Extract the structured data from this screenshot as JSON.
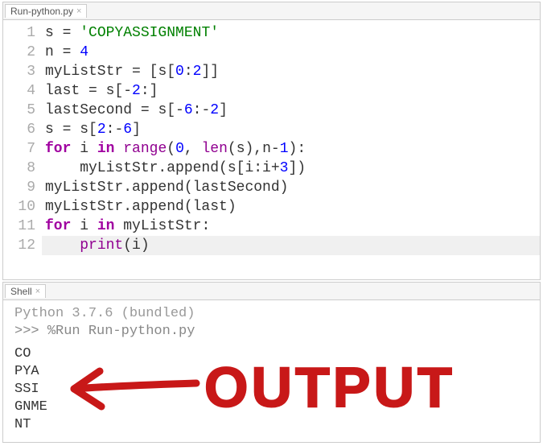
{
  "editor": {
    "tab_label": "Run-python.py",
    "lines": [
      {
        "n": "1",
        "tokens": [
          [
            "s ",
            "d"
          ],
          [
            "= ",
            "d"
          ],
          [
            "'COPYASSIGNMENT'",
            "s"
          ]
        ]
      },
      {
        "n": "2",
        "tokens": [
          [
            "n ",
            "d"
          ],
          [
            "= ",
            "d"
          ],
          [
            "4",
            "n"
          ]
        ]
      },
      {
        "n": "3",
        "tokens": [
          [
            "myListStr ",
            "d"
          ],
          [
            "= ",
            "d"
          ],
          [
            "[s[",
            "d"
          ],
          [
            "0",
            "n"
          ],
          [
            ":",
            "d"
          ],
          [
            "2",
            "n"
          ],
          [
            "]]",
            "d"
          ]
        ]
      },
      {
        "n": "4",
        "tokens": [
          [
            "last ",
            "d"
          ],
          [
            "= ",
            "d"
          ],
          [
            "s[-",
            "d"
          ],
          [
            "2",
            "n"
          ],
          [
            ":]",
            "d"
          ]
        ]
      },
      {
        "n": "5",
        "tokens": [
          [
            "lastSecond ",
            "d"
          ],
          [
            "= ",
            "d"
          ],
          [
            "s[-",
            "d"
          ],
          [
            "6",
            "n"
          ],
          [
            ":-",
            "d"
          ],
          [
            "2",
            "n"
          ],
          [
            "]",
            "d"
          ]
        ]
      },
      {
        "n": "6",
        "tokens": [
          [
            "s ",
            "d"
          ],
          [
            "= ",
            "d"
          ],
          [
            "s[",
            "d"
          ],
          [
            "2",
            "n"
          ],
          [
            ":-",
            "d"
          ],
          [
            "6",
            "n"
          ],
          [
            "]",
            "d"
          ]
        ]
      },
      {
        "n": "7",
        "tokens": [
          [
            "for ",
            "k"
          ],
          [
            "i ",
            "d"
          ],
          [
            "in ",
            "k"
          ],
          [
            "range",
            "b"
          ],
          [
            "(",
            "d"
          ],
          [
            "0",
            "n"
          ],
          [
            ", ",
            "d"
          ],
          [
            "len",
            "b"
          ],
          [
            "(s),n-",
            "d"
          ],
          [
            "1",
            "n"
          ],
          [
            "):",
            "d"
          ]
        ]
      },
      {
        "n": "8",
        "tokens": [
          [
            "    myListStr.append(s[i:i+",
            "d"
          ],
          [
            "3",
            "n"
          ],
          [
            "])",
            "d"
          ]
        ]
      },
      {
        "n": "9",
        "tokens": [
          [
            "myListStr.append(lastSecond)",
            "d"
          ]
        ]
      },
      {
        "n": "10",
        "tokens": [
          [
            "myListStr.append(last)",
            "d"
          ]
        ]
      },
      {
        "n": "11",
        "tokens": [
          [
            "for ",
            "k"
          ],
          [
            "i ",
            "d"
          ],
          [
            "in ",
            "k"
          ],
          [
            "myListStr:",
            "d"
          ]
        ]
      },
      {
        "n": "12",
        "tokens": [
          [
            "    ",
            "d"
          ],
          [
            "print",
            "b"
          ],
          [
            "(i)",
            "d"
          ]
        ],
        "hl": true
      }
    ]
  },
  "shell": {
    "tab_label": "Shell",
    "header": "Python 3.7.6 (bundled)",
    "prompt": ">>> ",
    "command": "%Run Run-python.py",
    "output": [
      "CO",
      "PYA",
      "SSI",
      "GNME",
      "NT"
    ]
  },
  "annotation": {
    "text": "OUTPUT",
    "color": "#c81818"
  }
}
